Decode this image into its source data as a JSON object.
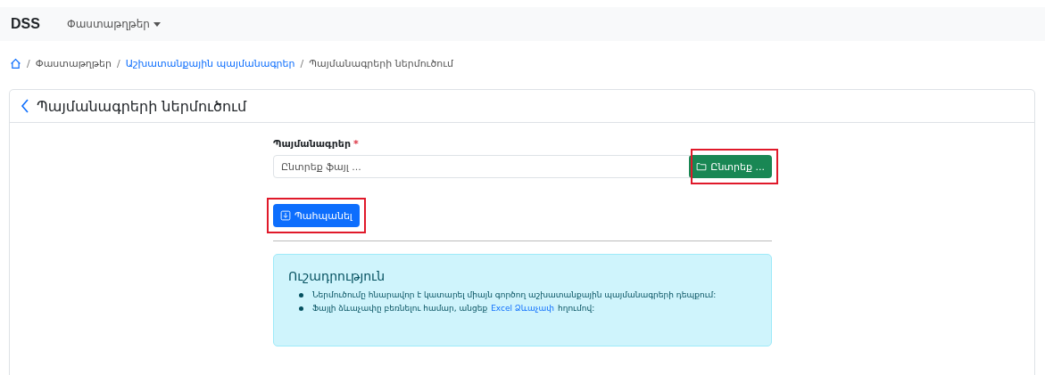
{
  "navbar": {
    "brand": "DSS",
    "menu": {
      "label": "Փաստաթղթեր"
    }
  },
  "breadcrumb_separator": "/",
  "breadcrumb": [
    {
      "label": "Փաստաթղթեր",
      "link": false
    },
    {
      "label": "Աշխատանքային պայմանագրեր",
      "link": true
    },
    {
      "label": "Պայմանագրերի ներմուծում",
      "link": false
    }
  ],
  "card": {
    "title": "Պայմանագրերի ներմուծում",
    "form": {
      "label": "Պայմանագրեր",
      "required_mark": "*",
      "placeholder": "Ընտրեք ֆայլ ...",
      "browse_button": {
        "label": "Ընտրեք ...",
        "highlighted": true
      },
      "save_button": {
        "label": "Պահպանել",
        "highlighted": true
      }
    },
    "alert": {
      "title": "Ուշադրություն",
      "items": [
        {
          "text": "Ներմուծումը հնարավոր է կատարել միայն գործող աշխատանքային պայմանագրերի դեպքում:"
        },
        {
          "text": "Ֆայլի ձևաչափը բեռնելու համար, անցեք",
          "link": "Excel Ձևաչափ",
          "after": "հղումով:"
        }
      ]
    }
  }
}
